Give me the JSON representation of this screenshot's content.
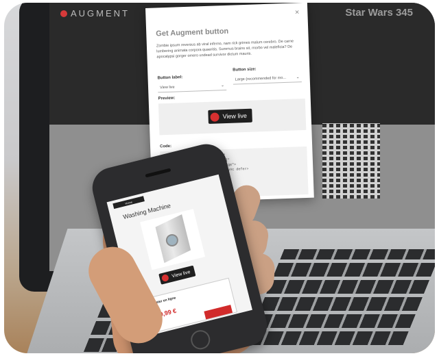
{
  "laptop": {
    "brand": "AUGMENT",
    "page_title": "Star Wars 345"
  },
  "modal": {
    "close_glyph": "×",
    "title": "Get Augment button",
    "description": "Zombie ipsum reversus ab viral inferno, nam rick grimes malum cerebro. De carne lumbering animata corpora quaeritis. Summus brains sit, morbo vel maleficia? De apocalypsi gorger omero undead survivor dictum mauris.",
    "button_label_label": "Button label:",
    "button_label_value": "View live",
    "button_size_label": "Button size:",
    "button_size_value": "Large (recommended for mo...",
    "preview_label": "Preview:",
    "preview_button_text": "View live",
    "code_label": "Code:",
    "code_lines": [
      "<a class=\"augment-try-button\"",
      "   data-string_host[=4e/3hdam]\"",
      "   data-size=\"small|medium|large\">",
      "",
      "<script src=\"...augment.js\" async defer>"
    ]
  },
  "phone": {
    "tab_label": "Home",
    "product_title": "Washing Machine",
    "view_live_label": "View live",
    "buy_label": "Acheter en ligne",
    "price": "319,99 €"
  },
  "colors": {
    "accent_red": "#d63030",
    "dark": "#1f1f1f"
  }
}
